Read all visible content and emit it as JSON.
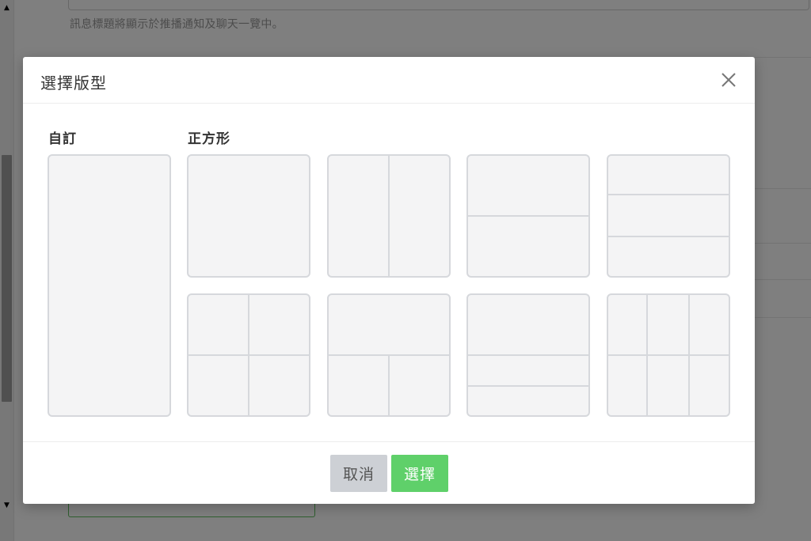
{
  "background": {
    "hint_text": "訊息標題將顯示於推播通知及聊天一覽中。",
    "scroll_up_glyph": "▲",
    "scroll_down_glyph": "▼"
  },
  "modal": {
    "title": "選擇版型",
    "close_icon": "close-icon",
    "sections": {
      "custom": "自訂",
      "square": "正方形"
    },
    "templates": [
      {
        "id": "custom-tall",
        "section": "custom"
      },
      {
        "id": "square-1",
        "section": "square"
      },
      {
        "id": "square-2-vertical",
        "section": "square"
      },
      {
        "id": "square-2-horizontal",
        "section": "square"
      },
      {
        "id": "square-3-rows",
        "section": "square"
      },
      {
        "id": "square-4-grid",
        "section": "square"
      },
      {
        "id": "square-1-top-2-bottom",
        "section": "square"
      },
      {
        "id": "square-1-top-2-rows",
        "section": "square"
      },
      {
        "id": "square-6-grid",
        "section": "square"
      }
    ],
    "footer": {
      "cancel_label": "取消",
      "select_label": "選擇"
    }
  },
  "colors": {
    "accent_green": "#5fd06a",
    "cancel_gray": "#cdd0d5",
    "tile_border": "#d6d8dc",
    "tile_fill": "#f4f4f5"
  }
}
